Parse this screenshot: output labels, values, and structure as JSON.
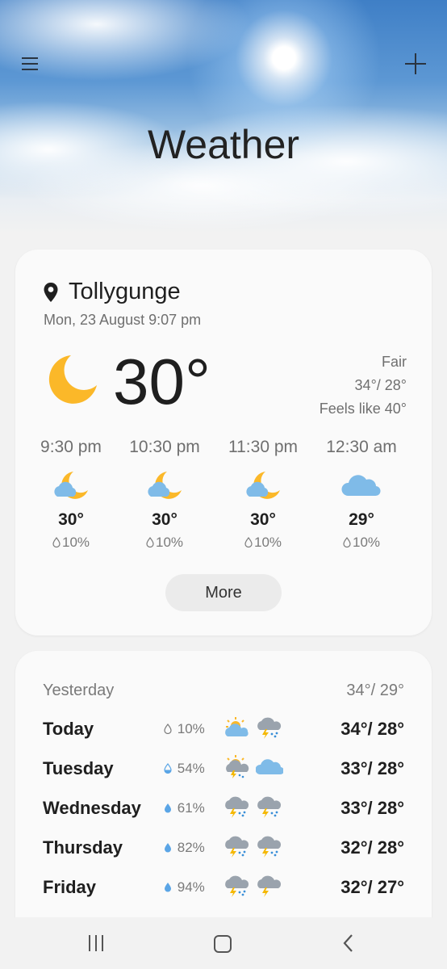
{
  "header": {
    "title": "Weather",
    "menu_icon": "hamburger-menu-icon",
    "add_icon": "plus-icon"
  },
  "current": {
    "location": "Tollygunge",
    "datetime": "Mon, 23 August 9:07 pm",
    "temperature": "30°",
    "condition": "Fair",
    "high_low": "34°/ 28°",
    "feels_like": "Feels like 40°",
    "icon": "crescent-moon-icon"
  },
  "hourly": [
    {
      "time": "9:30 pm",
      "icon": "moon-cloud-icon",
      "temp": "30°",
      "precip": "10%"
    },
    {
      "time": "10:30 pm",
      "icon": "moon-cloud-icon",
      "temp": "30°",
      "precip": "10%"
    },
    {
      "time": "11:30 pm",
      "icon": "moon-cloud-icon",
      "temp": "30°",
      "precip": "10%"
    },
    {
      "time": "12:30 am",
      "icon": "cloud-icon",
      "temp": "29°",
      "precip": "10%"
    }
  ],
  "more_label": "More",
  "daily": {
    "yesterday": {
      "label": "Yesterday",
      "temps": "34°/ 29°"
    },
    "days": [
      {
        "day": "Today",
        "precip": "10%",
        "day_icon": "sun-cloud-icon",
        "night_icon": "thunderstorm-icon",
        "temps": "34°/ 28°"
      },
      {
        "day": "Tuesday",
        "precip": "54%",
        "day_icon": "sun-thunderstorm-icon",
        "night_icon": "cloud-icon",
        "temps": "33°/ 28°"
      },
      {
        "day": "Wednesday",
        "precip": "61%",
        "day_icon": "thunderstorm-icon",
        "night_icon": "thunderstorm-icon",
        "temps": "33°/ 28°"
      },
      {
        "day": "Thursday",
        "precip": "82%",
        "day_icon": "thunderstorm-icon",
        "night_icon": "thunderstorm-icon",
        "temps": "32°/ 28°"
      },
      {
        "day": "Friday",
        "precip": "94%",
        "day_icon": "thunderstorm-icon",
        "night_icon": "thunderstorm-icon",
        "temps": "32°/ 27°"
      }
    ]
  },
  "colors": {
    "moon": "#fbb829",
    "cloud": "#7fbbe8",
    "storm_cloud": "#9aa3ad",
    "bolt": "#f5b800",
    "rain": "#3a8fd8"
  },
  "nav": {
    "recent_icon": "recent-apps-icon",
    "home_icon": "home-icon",
    "back_icon": "back-icon"
  }
}
